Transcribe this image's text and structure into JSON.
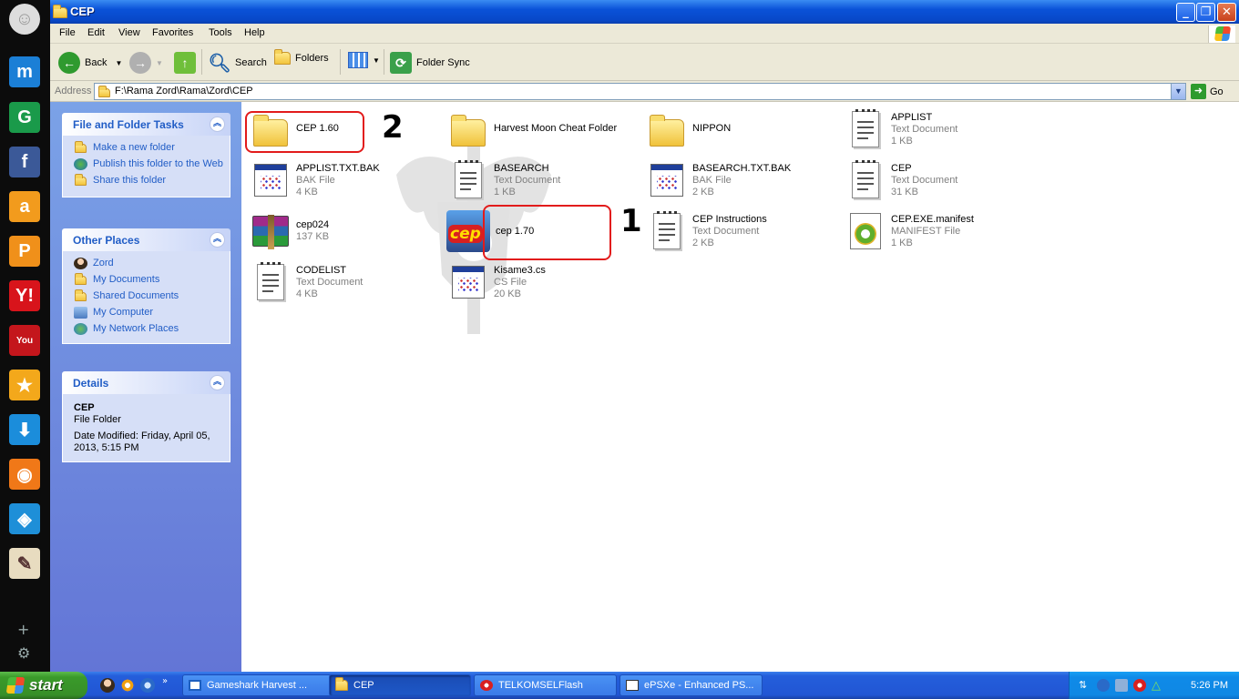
{
  "window": {
    "title": "CEP"
  },
  "menu": {
    "items": [
      "File",
      "Edit",
      "View",
      "Favorites",
      "Tools",
      "Help"
    ]
  },
  "toolbar": {
    "back": "Back",
    "search": "Search",
    "folders": "Folders",
    "folder_sync": "Folder Sync"
  },
  "address": {
    "label": "Address",
    "value": "F:\\Rama Zord\\Rama\\Zord\\CEP",
    "go": "Go"
  },
  "tasks": {
    "file_folder": {
      "title": "File and Folder Tasks",
      "items": [
        "Make a new folder",
        "Publish this folder to the Web",
        "Share this folder"
      ]
    },
    "other_places": {
      "title": "Other Places",
      "items": [
        "Zord",
        "My Documents",
        "Shared Documents",
        "My Computer",
        "My Network Places"
      ]
    },
    "details": {
      "title": "Details",
      "name": "CEP",
      "type": "File Folder",
      "modified": "Date Modified: Friday, April 05, 2013, 5:15 PM"
    }
  },
  "files": [
    {
      "name": "CEP 1.60",
      "kind": "",
      "size": "",
      "icon": "folder-icon"
    },
    {
      "name": "Harvest Moon Cheat Folder",
      "kind": "",
      "size": "",
      "icon": "folder-icon"
    },
    {
      "name": "NIPPON",
      "kind": "",
      "size": "",
      "icon": "folder-icon"
    },
    {
      "name": "APPLIST",
      "kind": "Text Document",
      "size": "1 KB",
      "icon": "text-document-icon"
    },
    {
      "name": "APPLIST.TXT.BAK",
      "kind": "BAK File",
      "size": "4 KB",
      "icon": "bak-file-icon"
    },
    {
      "name": "BASEARCH",
      "kind": "Text Document",
      "size": "1 KB",
      "icon": "text-document-icon"
    },
    {
      "name": "BASEARCH.TXT.BAK",
      "kind": "BAK File",
      "size": "2 KB",
      "icon": "bak-file-icon"
    },
    {
      "name": "CEP",
      "kind": "Text Document",
      "size": "31 KB",
      "icon": "text-document-icon"
    },
    {
      "name": "cep024",
      "kind": "",
      "size": "137 KB",
      "icon": "winrar-archive-icon"
    },
    {
      "name": "cep 1.70",
      "kind": "",
      "size": "",
      "icon": "cep-app-icon"
    },
    {
      "name": "CEP Instructions",
      "kind": "Text Document",
      "size": "2 KB",
      "icon": "text-document-icon"
    },
    {
      "name": "CEP.EXE.manifest",
      "kind": "MANIFEST File",
      "size": "1 KB",
      "icon": "manifest-file-icon"
    },
    {
      "name": "CODELIST",
      "kind": "Text Document",
      "size": "4 KB",
      "icon": "text-document-icon"
    },
    {
      "name": "Kisame3.cs",
      "kind": "CS File",
      "size": "20 KB",
      "icon": "cs-file-icon"
    }
  ],
  "annotations": {
    "one": "1",
    "two": "2"
  },
  "taskbar": {
    "start": "start",
    "buttons": [
      "Gameshark Harvest ...",
      "CEP",
      "TELKOMSELFlash",
      "ePSXe - Enhanced PS..."
    ],
    "clock": "5:26 PM"
  },
  "colors": {
    "highlight": "#e21b1b",
    "link": "#215dc6",
    "titlebar": "#0a52d8"
  }
}
